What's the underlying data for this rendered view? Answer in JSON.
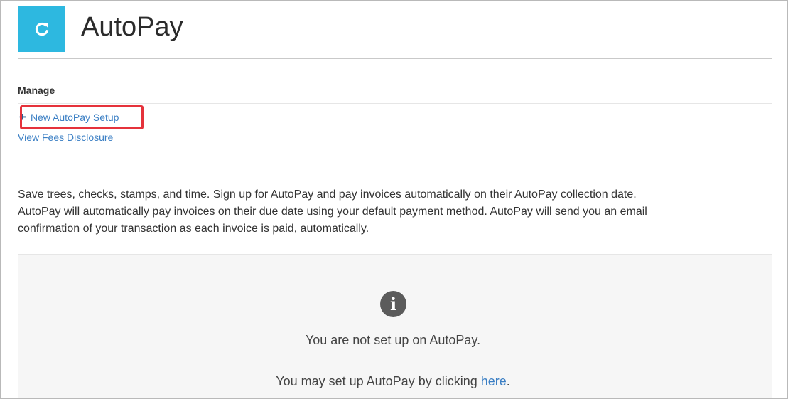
{
  "header": {
    "title": "AutoPay",
    "logo_icon": "refresh-icon",
    "logo_color": "#2db8e0"
  },
  "manage": {
    "heading": "Manage",
    "new_setup_icon": "plus-icon",
    "new_setup_label": "New AutoPay Setup",
    "fees_label": "View Fees Disclosure"
  },
  "description": {
    "line1": "Save trees, checks, stamps, and time. Sign up for AutoPay and pay invoices automatically on their AutoPay collection date.",
    "line2": "AutoPay will automatically pay invoices on their due date using your default payment method. AutoPay will send you an email",
    "line3": "confirmation of your transaction as each invoice is paid, automatically."
  },
  "status_panel": {
    "icon": "info-icon",
    "message": "You are not set up on AutoPay.",
    "instruction_prefix": "You may set up AutoPay by clicking ",
    "instruction_link": "here",
    "instruction_suffix": "."
  },
  "colors": {
    "link": "#3b7fc4",
    "highlight": "#e5323b",
    "panel_bg": "#f6f6f6"
  }
}
